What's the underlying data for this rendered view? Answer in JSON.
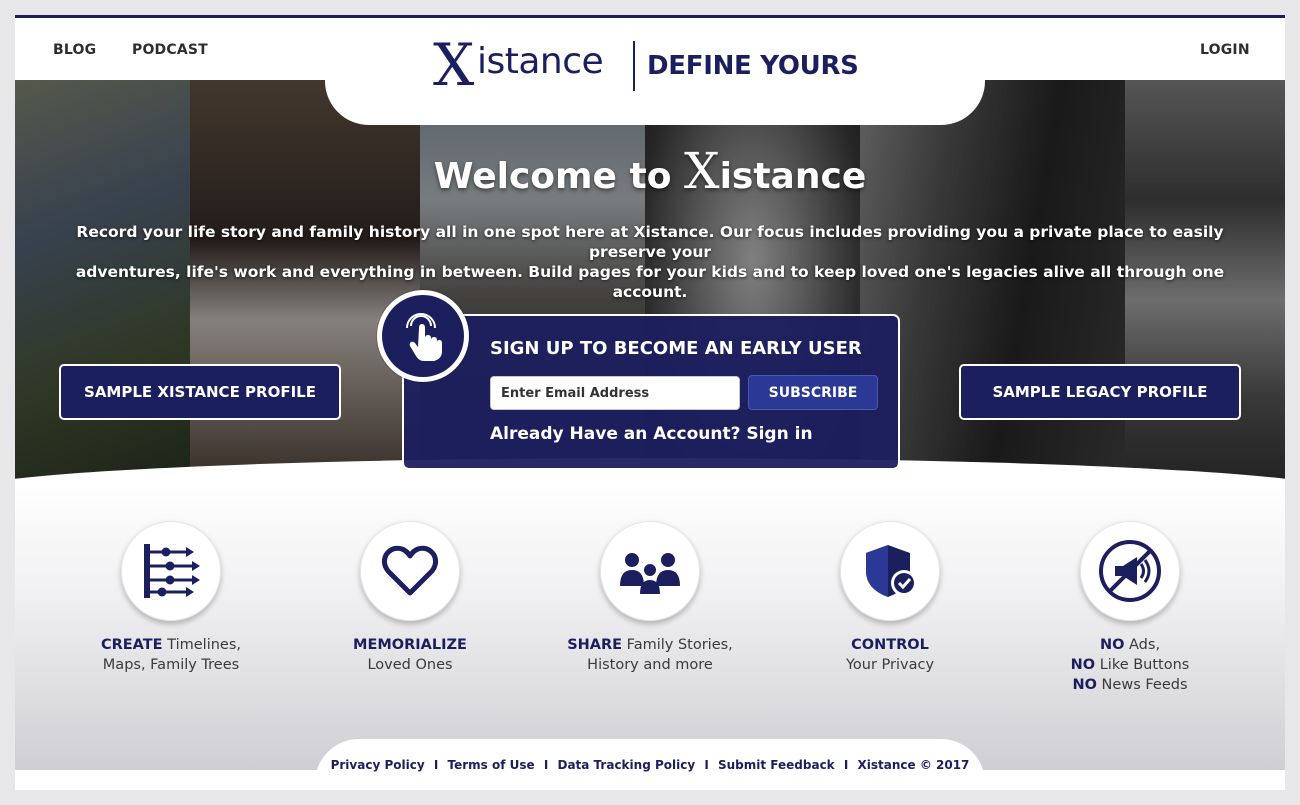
{
  "header": {
    "nav_left": [
      "BLOG",
      "PODCAST"
    ],
    "login": "LOGIN",
    "logo": {
      "mark": "X",
      "word": "istance",
      "tagline": "DEFINE YOURS"
    }
  },
  "hero": {
    "welcome_prefix": "Welcome to ",
    "welcome_x": "X",
    "welcome_word": "istance",
    "intro_line1": "Record your life story and family history all in one spot here at Xistance. Our focus includes providing you a private place to easily preserve your",
    "intro_line2": "adventures, life's work and everything in between. Build pages for your kids and to keep loved one's legacies alive all through one account.",
    "sample_left": "SAMPLE XISTANCE PROFILE",
    "sample_right": "SAMPLE LEGACY PROFILE"
  },
  "signup": {
    "title": "SIGN UP TO BECOME AN EARLY USER",
    "email_placeholder": "Enter Email Address",
    "subscribe_label": "SUBSCRIBE",
    "signin_text": "Already Have an Account? Sign in"
  },
  "features": [
    {
      "icon": "timeline-icon",
      "bold1": "CREATE",
      "rest1": " Timelines,",
      "line2": "Maps, Family Trees"
    },
    {
      "icon": "heart-icon",
      "bold1": "MEMORIALIZE",
      "rest1": "",
      "line2": "Loved Ones"
    },
    {
      "icon": "family-icon",
      "bold1": "SHARE",
      "rest1": " Family Stories,",
      "line2": "History and more"
    },
    {
      "icon": "privacy-shield-icon",
      "bold1": "CONTROL",
      "rest1": "",
      "line2": "Your Privacy"
    },
    {
      "icon": "no-ads-icon",
      "lines": [
        {
          "bold": "NO",
          "rest": " Ads,"
        },
        {
          "bold": "NO",
          "rest": " Like Buttons"
        },
        {
          "bold": "NO",
          "rest": " News Feeds"
        }
      ]
    }
  ],
  "footer": {
    "links": [
      "Privacy Policy",
      "Terms of Use",
      "Data Tracking Policy",
      "Submit Feedback"
    ],
    "separator": "I",
    "copyright": "Xistance © 2017"
  },
  "colors": {
    "brand": "#1b1f5e",
    "button": "#2b3896",
    "text": "#3a3a3a"
  }
}
